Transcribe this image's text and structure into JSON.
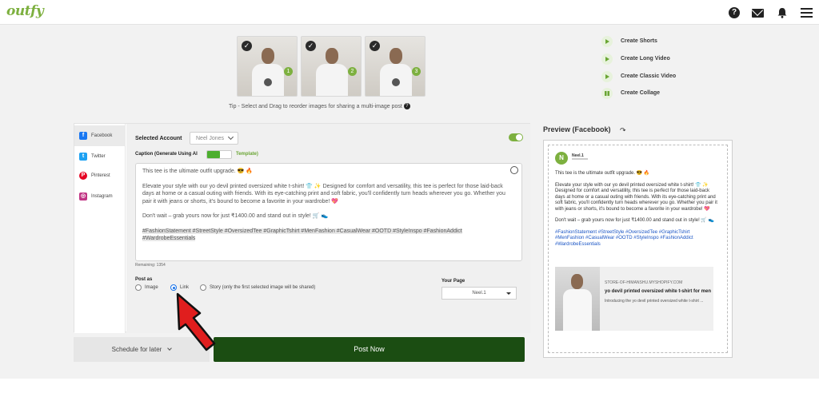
{
  "brand": {
    "logo": "outfy"
  },
  "header": {
    "help": "?"
  },
  "thumbnails": [
    {
      "number": "1"
    },
    {
      "number": "2"
    },
    {
      "number": "3"
    }
  ],
  "tip": "Tip - Select and Drag to reorder images for sharing a multi-image post",
  "create_options": [
    {
      "label": "Create Shorts",
      "icon": "play-icon"
    },
    {
      "label": "Create Long Video",
      "icon": "play-icon"
    },
    {
      "label": "Create Classic Video",
      "icon": "play-icon"
    },
    {
      "label": "Create Collage",
      "icon": "grid-icon"
    }
  ],
  "sidebar": {
    "items": [
      {
        "label": "Facebook",
        "icon": "facebook-icon",
        "glyph": "f",
        "color": "#1877f2",
        "active": true
      },
      {
        "label": "Twitter",
        "icon": "twitter-icon",
        "glyph": "t",
        "color": "#1da1f2",
        "active": false
      },
      {
        "label": "Pinterest",
        "icon": "pinterest-icon",
        "glyph": "P",
        "color": "#e60023",
        "active": false
      },
      {
        "label": "Instagram",
        "icon": "instagram-icon",
        "glyph": "◎",
        "color": "#c13584",
        "active": false
      }
    ]
  },
  "account": {
    "label": "Selected Account",
    "value": "Neel Jones"
  },
  "caption": {
    "label": "Caption (Generate Using AI",
    "template_label": "Template)",
    "line1": "This tee is the ultimate outfit upgrade. 😎 🔥",
    "para2": "Elevate your style with our yo devil printed oversized white t-shirt! 👕 ✨ Designed for comfort and versatility, this tee is perfect for those laid-back days at home or a casual outing with friends. With its eye-catching print and soft fabric, you'll confidently turn heads wherever you go. Whether you pair it with jeans or shorts, it's bound to become a favorite in your wardrobe! 💖",
    "para3": "Don't wait – grab yours now for just ₹1400.00 and stand out in style! 🛒 👟",
    "hashtags": "#FashionStatement #StreetStyle #OversizedTee #GraphicTshirt #MenFashion #CasualWear #OOTD #StyleInspo #FashionAddict #WardrobeEssentials",
    "remaining": "Remaining: 1354"
  },
  "post_as": {
    "label": "Post as",
    "options": [
      {
        "label": "Image",
        "selected": false
      },
      {
        "label": "Link",
        "selected": true
      },
      {
        "label": "Story (only the first selected image will be shared)",
        "selected": false
      }
    ]
  },
  "page": {
    "label": "Your Page",
    "value": "Neel.1"
  },
  "actions": {
    "schedule": "Schedule for later",
    "post_now": "Post Now"
  },
  "preview": {
    "title": "Preview (Facebook)",
    "avatar_letter": "N",
    "name": "Neel.1",
    "line1": "This tee is the ultimate outfit upgrade. 😎 🔥",
    "para2": "Elevate your style with our yo devil printed oversized white t-shirt! 👕 ✨ Designed for comfort and versatility, this tee is perfect for those laid-back days at home or a casual outing with friends. With its eye-catching print and soft fabric, you'll confidently turn heads wherever you go. Whether you pair it with jeans or shorts, it's bound to become a favorite in your wardrobe! 💖",
    "para3": "Don't wait – grab yours now for just ₹1400.00 and stand out in style! 🛒 👟",
    "hashtags": "#FashionStatement #StreetStyle #OversizedTee #GraphicTshirt #MenFashion #CasualWear #OOTD #StyleInspo #FashionAddict #WardrobeEssentials",
    "link_domain": "STORE-OF-HIMANSHU.MYSHOPIFY.COM",
    "link_title": "yo devil printed oversized white t-shirt for men",
    "link_desc": "Introducing the yo devil printed oversized white t-shirt ..."
  },
  "colors": {
    "accent": "#7db03f",
    "post_button": "#1b4d12",
    "arrow": "#e01e1e"
  }
}
